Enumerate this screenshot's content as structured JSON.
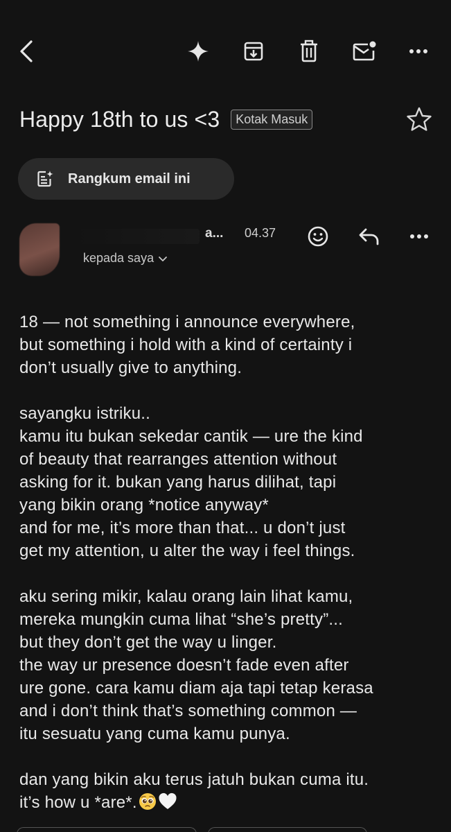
{
  "toolbar": {
    "back_icon": "back-arrow-icon",
    "sparkle_icon": "gemini-sparkle-icon",
    "archive_icon": "archive-icon",
    "delete_icon": "trash-icon",
    "mark_unread_icon": "mark-unread-icon",
    "more_icon": "more-horizontal-icon"
  },
  "email": {
    "subject": "Happy 18th to us <3",
    "label": "Kotak Masuk",
    "summarize_label": "Rangkum email ini",
    "sender_name_visible": "a...",
    "time": "04.37",
    "recipients": "kepada saya",
    "body_lines": [
      "18 — not something i announce everywhere,",
      "but something i hold with a kind of certainty i",
      "don’t usually give to anything.",
      "",
      "sayangku istriku..",
      "kamu itu bukan sekedar cantik — ure the kind",
      "of beauty that rearranges attention without",
      "asking for it. bukan yang harus dilihat, tapi",
      "yang bikin orang *notice anyway*",
      "and for me, it’s more than that... u don’t just",
      "get my attention, u alter the way i feel things.",
      "",
      "aku sering mikir, kalau orang lain lihat kamu,",
      "mereka mungkin cuma lihat “she’s pretty”...",
      "but they don’t get the way u linger.",
      "the way ur presence doesn’t fade even after",
      "ure gone. cara kamu diam aja tapi tetap kerasa",
      "and i don’t think that’s something common —",
      "itu sesuatu yang cuma kamu punya.",
      "",
      "dan yang bikin aku terus jatuh bukan cuma itu.",
      "it’s how u *are*."
    ],
    "trailing_emojis": [
      "pleading-face-emoji",
      "white-heart-emoji"
    ]
  },
  "colors": {
    "background": "#131313",
    "chip_background": "#2a2a2a",
    "text": "#e9e9e9"
  }
}
